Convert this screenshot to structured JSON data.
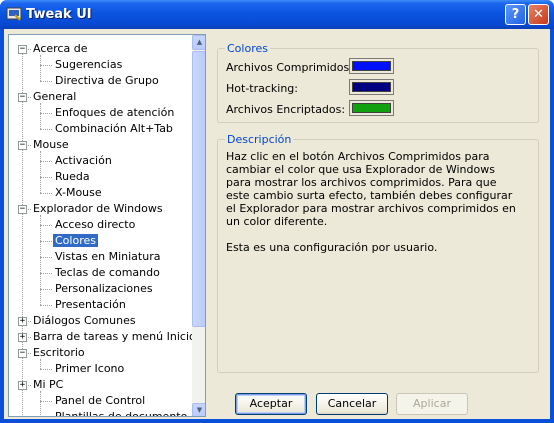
{
  "window": {
    "title": "Tweak UI"
  },
  "titlebar": {
    "help_label": "?",
    "close_label": "✕"
  },
  "tree": {
    "items": [
      {
        "label": "Acerca de",
        "expander": "−"
      },
      {
        "label": "Sugerencias"
      },
      {
        "label": "Directiva de Grupo"
      },
      {
        "label": "General",
        "expander": "−"
      },
      {
        "label": "Enfoques de atención"
      },
      {
        "label": "Combinación Alt+Tab"
      },
      {
        "label": "Mouse",
        "expander": "−"
      },
      {
        "label": "Activación"
      },
      {
        "label": "Rueda"
      },
      {
        "label": "X-Mouse"
      },
      {
        "label": "Explorador de Windows",
        "expander": "−"
      },
      {
        "label": "Acceso directo"
      },
      {
        "label": "Colores",
        "selected": true
      },
      {
        "label": "Vistas en Miniatura"
      },
      {
        "label": "Teclas de comando"
      },
      {
        "label": "Personalizaciones"
      },
      {
        "label": "Presentación"
      },
      {
        "label": "Diálogos Comunes",
        "expander": "+"
      },
      {
        "label": "Barra de tareas y menú Inicio",
        "expander": "+"
      },
      {
        "label": "Escritorio",
        "expander": "−"
      },
      {
        "label": "Primer Icono"
      },
      {
        "label": "Mi PC",
        "expander": "+"
      },
      {
        "label": "Panel de Control"
      },
      {
        "label": "Plantillas de documento"
      }
    ]
  },
  "colors_group": {
    "title": "Colores",
    "rows": [
      {
        "label": "Archivos Comprimidos:",
        "color": "#0010f8"
      },
      {
        "label": "Hot-tracking:",
        "color": "#000080"
      },
      {
        "label": "Archivos Encriptados:",
        "color": "#10a010"
      }
    ]
  },
  "description_group": {
    "title": "Descripción",
    "paragraph1": "Haz clic en el botón Archivos Comprimidos para cambiar el color que usa Explorador de Windows para mostrar los archivos comprimidos. Para que este cambio surta efecto, también debes configurar el Explorador para mostrar archivos comprimidos en un color diferente.",
    "paragraph2": "Esta es una configuración por usuario."
  },
  "buttons": {
    "accept_label": "Aceptar",
    "cancel_label": "Cancelar",
    "apply_label": "Aplicar"
  }
}
